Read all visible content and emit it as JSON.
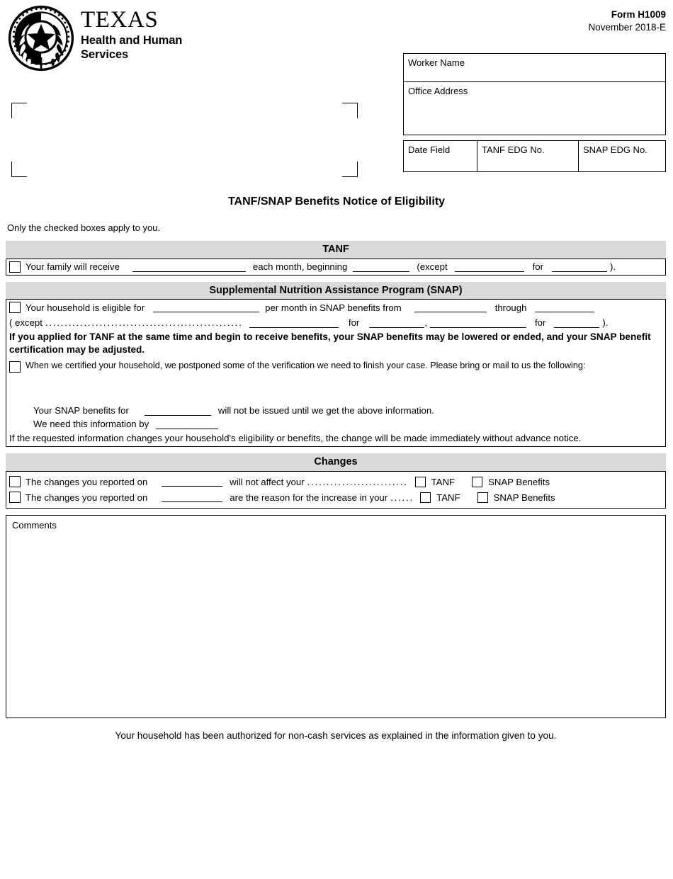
{
  "header": {
    "logo": {
      "seal_icon": "texas-state-seal-icon",
      "line1": "TEXAS",
      "line2": "Health and Human",
      "line3": "Services"
    },
    "form_number": "Form H1009",
    "form_revision": "November 2018-E"
  },
  "worker_block": {
    "worker_name_label": "Worker Name",
    "office_address_label": "Office Address",
    "date_field_label": "Date Field",
    "tanf_edg_label": "TANF EDG No.",
    "snap_edg_label": "SNAP EDG No."
  },
  "title": "TANF/SNAP Benefits Notice of Eligibility",
  "instruction": "Only the checked boxes apply to you.",
  "tanf": {
    "heading": "TANF",
    "row": {
      "text1": "Your family will receive",
      "text2": "each month, beginning",
      "text3": "(except",
      "text4": "for",
      "text5": ")."
    }
  },
  "snap": {
    "heading": "Supplemental Nutrition Assistance Program (SNAP)",
    "eligible_row": {
      "text1": "Your household is eligible for",
      "text2": "per month in SNAP benefits from",
      "text3": "through"
    },
    "except_row": {
      "text1": "( except",
      "dots": "..........................................................",
      "text2": "for",
      "comma": ",",
      "text3": "for",
      "text4": ")."
    },
    "bold_note": "If you applied for TANF at the same time and begin to receive benefits, your SNAP benefits may be lowered or ended, and your SNAP benefit certification may be adjusted.",
    "postponed_text": "When we certified your household, we postponed some of the verification we need to finish your case. Please bring or mail to us the following:",
    "benefits_for_text1": "Your SNAP benefits for",
    "benefits_for_text2": "will not be issued until we get the above information.",
    "need_by_text": "We need this information by",
    "change_note": "If the requested information changes your household's eligibility or benefits, the change will be made immediately without advance notice."
  },
  "changes": {
    "heading": "Changes",
    "rows": [
      {
        "text1": "The changes you reported on",
        "text2": "will not affect your",
        "dots": "....................................",
        "opt1": "TANF",
        "opt2": "SNAP Benefits"
      },
      {
        "text1": "The changes you reported on",
        "text2": "are the reason for the increase in your",
        "dots": "......",
        "opt1": "TANF",
        "opt2": "SNAP Benefits"
      }
    ]
  },
  "comments": {
    "label": "Comments"
  },
  "footer_note": "Your household has been authorized for non-cash services as explained in the information given to you.",
  "colors": {
    "section_header_bg": "#d9d9d9",
    "border": "#000000",
    "page_bg": "#ffffff"
  }
}
